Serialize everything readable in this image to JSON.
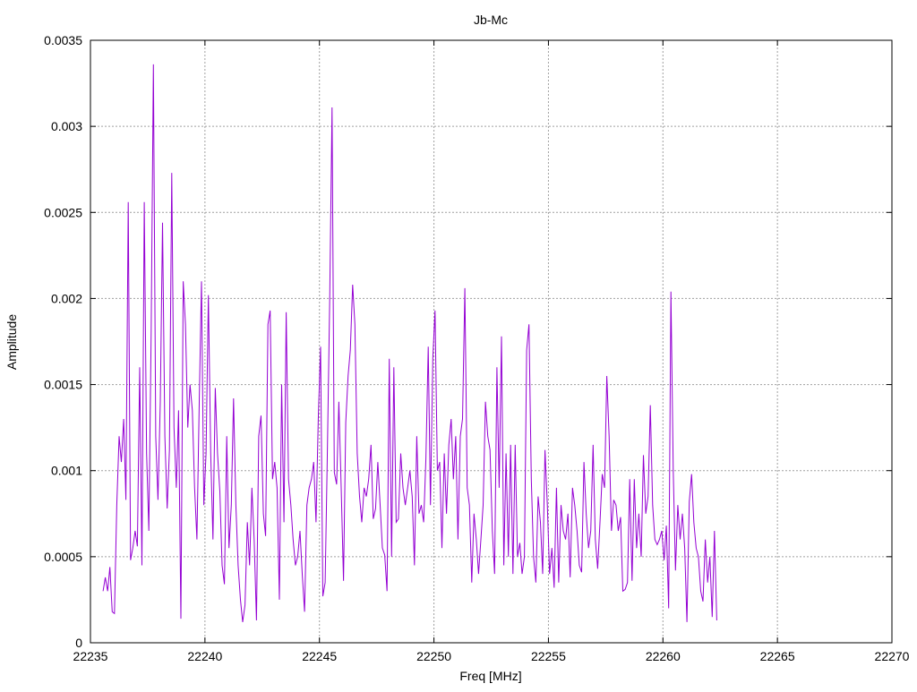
{
  "chart_data": {
    "type": "line",
    "title": "Jb-Mc",
    "xlabel": "Freq [MHz]",
    "ylabel": "Amplitude",
    "xlim": [
      22235,
      22270
    ],
    "ylim": [
      0,
      0.0035
    ],
    "x_ticks": [
      "22235",
      "22240",
      "22245",
      "22250",
      "22255",
      "22260",
      "22265",
      "22270"
    ],
    "y_ticks": [
      "0",
      "0.0005",
      "0.001",
      "0.0015",
      "0.002",
      "0.0025",
      "0.003",
      "0.0035"
    ],
    "grid": true,
    "line_color": "#9400d3",
    "x_start": 22235.55,
    "x_step": 0.1,
    "series": [
      {
        "values": [
          0.0003,
          0.00038,
          0.0003,
          0.00044,
          0.00018,
          0.00017,
          0.0008,
          0.0012,
          0.00105,
          0.0013,
          0.00083,
          0.00256,
          0.00048,
          0.00055,
          0.00065,
          0.00056,
          0.0016,
          0.00045,
          0.00256,
          0.0011,
          0.00065,
          0.0018,
          0.00336,
          0.0012,
          0.00083,
          0.0014,
          0.00244,
          0.0012,
          0.00078,
          0.00112,
          0.00273,
          0.00125,
          0.0009,
          0.00135,
          0.00014,
          0.0021,
          0.00185,
          0.00125,
          0.0015,
          0.00135,
          0.0009,
          0.0006,
          0.0014,
          0.0021,
          0.0008,
          0.0011,
          0.00202,
          0.0011,
          0.0006,
          0.00148,
          0.0011,
          0.00088,
          0.00045,
          0.00034,
          0.0012,
          0.00055,
          0.0008,
          0.00142,
          0.0008,
          0.00045,
          0.00025,
          0.00012,
          0.00022,
          0.0007,
          0.00045,
          0.0009,
          0.0006,
          0.00013,
          0.0012,
          0.00132,
          0.00075,
          0.00062,
          0.00185,
          0.00193,
          0.00095,
          0.00105,
          0.0009,
          0.00025,
          0.0015,
          0.0007,
          0.00192,
          0.00095,
          0.0008,
          0.0006,
          0.00045,
          0.0005,
          0.00065,
          0.0004,
          0.00018,
          0.0008,
          0.0009,
          0.00095,
          0.00105,
          0.0007,
          0.0013,
          0.00172,
          0.00027,
          0.00035,
          0.00115,
          0.002,
          0.00311,
          0.00099,
          0.00092,
          0.0014,
          0.0009,
          0.00036,
          0.00128,
          0.00155,
          0.0017,
          0.00208,
          0.00185,
          0.0011,
          0.00085,
          0.0007,
          0.0009,
          0.00085,
          0.00095,
          0.00115,
          0.00072,
          0.00078,
          0.00105,
          0.0008,
          0.00055,
          0.00051,
          0.0003,
          0.00165,
          0.0005,
          0.0016,
          0.0007,
          0.00072,
          0.0011,
          0.0009,
          0.0008,
          0.0009,
          0.001,
          0.00085,
          0.00045,
          0.0012,
          0.00075,
          0.0008,
          0.0007,
          0.00107,
          0.00172,
          0.0008,
          0.00165,
          0.00193,
          0.001,
          0.00105,
          0.00055,
          0.0011,
          0.00075,
          0.00115,
          0.0013,
          0.00095,
          0.0012,
          0.0006,
          0.0012,
          0.0013,
          0.00206,
          0.0009,
          0.0008,
          0.00035,
          0.00075,
          0.0006,
          0.0004,
          0.0006,
          0.0008,
          0.0014,
          0.0012,
          0.00112,
          0.00065,
          0.0004,
          0.0016,
          0.0009,
          0.00178,
          0.00045,
          0.0011,
          0.0005,
          0.00115,
          0.0004,
          0.00115,
          0.0005,
          0.00058,
          0.0004,
          0.0005,
          0.0017,
          0.00185,
          0.00095,
          0.0005,
          0.00035,
          0.00085,
          0.0007,
          0.0004,
          0.00112,
          0.0008,
          0.0004,
          0.00055,
          0.00032,
          0.0009,
          0.00035,
          0.0008,
          0.00065,
          0.0006,
          0.00075,
          0.00038,
          0.0009,
          0.0008,
          0.00065,
          0.00045,
          0.00041,
          0.00105,
          0.00075,
          0.00055,
          0.00065,
          0.00115,
          0.0006,
          0.00043,
          0.0007,
          0.00098,
          0.0009,
          0.00155,
          0.0012,
          0.00065,
          0.00083,
          0.0008,
          0.00065,
          0.00073,
          0.0003,
          0.00031,
          0.00035,
          0.00095,
          0.00036,
          0.00095,
          0.00055,
          0.00075,
          0.0005,
          0.00109,
          0.00075,
          0.00085,
          0.00138,
          0.0008,
          0.0006,
          0.00057,
          0.0006,
          0.00065,
          0.00048,
          0.00068,
          0.0002,
          0.00204,
          0.001,
          0.00042,
          0.0008,
          0.0006,
          0.00075,
          0.00055,
          0.00012,
          0.00082,
          0.00098,
          0.0007,
          0.00055,
          0.0005,
          0.0003,
          0.00024,
          0.0006,
          0.00035,
          0.0005,
          0.00015,
          0.00065,
          0.00013
        ]
      }
    ]
  }
}
